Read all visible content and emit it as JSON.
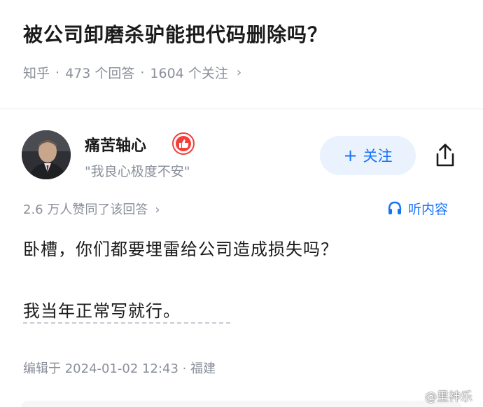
{
  "question": {
    "title": "被公司卸磨杀驴能把代码删除吗？",
    "source": "知乎",
    "answer_count": "473 个回答",
    "follower_count": "1604 个关注",
    "separator": "·",
    "chevron": "›"
  },
  "author": {
    "name": "痛苦轴心",
    "bio": "\"我良心极度不安\"",
    "follow_label": "关注",
    "follow_plus": "+"
  },
  "answer": {
    "upvote_summary": "2.6 万人赞同了该回答",
    "upvote_chevron": "›",
    "listen_label": "听内容",
    "paragraphs": [
      "卧槽，你们都要埋雷给公司造成损失吗？",
      "我当年正常写就行。"
    ],
    "edit_info": "编辑于 2024-01-02 12:43 · 福建"
  },
  "watermark": {
    "text": "@里神乐"
  },
  "colors": {
    "accent": "#1772f6",
    "accent_bg": "#eaf2fe",
    "muted_text": "#8a8f99",
    "primary_text": "#1a1a1a",
    "badge": "#f1403c"
  },
  "icons": {
    "share": "share-icon",
    "headphones": "headphones-icon",
    "badge": "thumbs-up-badge-icon",
    "weibo": "weibo-icon"
  }
}
